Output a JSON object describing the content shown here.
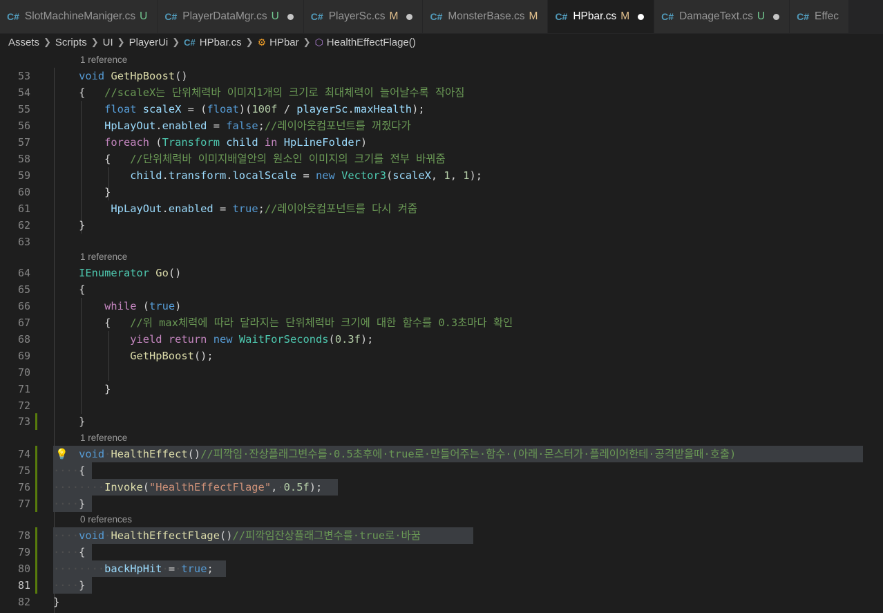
{
  "tabs": [
    {
      "name": "SlotMachineManiger.cs",
      "status": "U",
      "dirty": false,
      "active": false
    },
    {
      "name": "PlayerDataMgr.cs",
      "status": "U",
      "dirty": true,
      "active": false
    },
    {
      "name": "PlayerSc.cs",
      "status": "M",
      "dirty": true,
      "active": false
    },
    {
      "name": "MonsterBase.cs",
      "status": "M",
      "dirty": false,
      "active": false
    },
    {
      "name": "HPbar.cs",
      "status": "M",
      "dirty": true,
      "active": true
    },
    {
      "name": "DamageText.cs",
      "status": "U",
      "dirty": true,
      "active": false
    },
    {
      "name": "Effec",
      "status": "",
      "dirty": false,
      "active": false
    }
  ],
  "breadcrumb": [
    "Assets",
    "Scripts",
    "UI",
    "PlayerUi",
    "HPbar.cs",
    "HPbar",
    "HealthEffectFlage()"
  ],
  "editor": {
    "code_lens": {
      "l53": "1 reference",
      "l64": "1 reference",
      "l74": "1 reference",
      "l78": "0 references"
    },
    "line_numbers": {
      "l53": "53",
      "l54": "54",
      "l55": "55",
      "l56": "56",
      "l57": "57",
      "l58": "58",
      "l59": "59",
      "l60": "60",
      "l61": "61",
      "l62": "62",
      "l63": "63",
      "l64": "64",
      "l65": "65",
      "l66": "66",
      "l67": "67",
      "l68": "68",
      "l69": "69",
      "l70": "70",
      "l71": "71",
      "l72": "72",
      "l73": "73",
      "l74": "74",
      "l75": "75",
      "l76": "76",
      "l77": "77",
      "l78": "78",
      "l79": "79",
      "l80": "80",
      "l81": "81",
      "l82": "82"
    },
    "comments": {
      "l54": "//scaleX는 단위체력바 이미지1개의 크기로 최대체력이 늘어날수록 작아짐",
      "l56": "//레이아웃컴포넌트를 꺼줬다가",
      "l58": "//단위체력바 이미지배열안의 원소인 이미지의 크기를 전부 바꿔줌",
      "l61": "//레이아웃컴포넌트를 다시 켜줌",
      "l67": "//위 max체력에 따라 달라지는 단위체력바 크기에 대한 함수를 0.3초마다 확인",
      "l74": "//피깍임·잔상플래그변수를·0.5초후에·true로·만들어주는·함수·(아래·몬스터가·플레이어한테·공격받을때·호출)",
      "l78": "//피깍임잔상플래그변수를·true로·바꿈"
    },
    "strings": {
      "l76": "\"HealthEffectFlage\""
    },
    "numbers": {
      "l55": "100f",
      "l59a": "1",
      "l59b": "1",
      "l68": "0.3f",
      "l76": "0.5f"
    }
  }
}
